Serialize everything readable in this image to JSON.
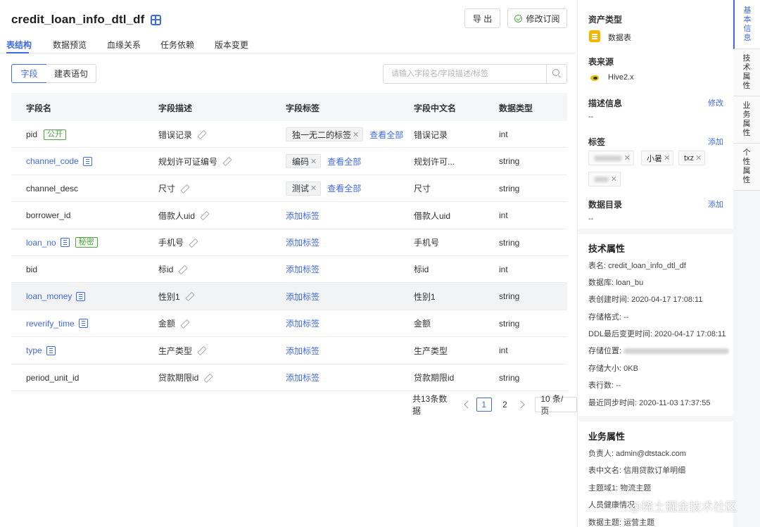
{
  "header": {
    "title": "credit_loan_info_dtl_df",
    "export_label": "导 出",
    "subscribe_label": "修改订阅"
  },
  "tabs": [
    "表结构",
    "数据预览",
    "血缘关系",
    "任务依赖",
    "版本变更"
  ],
  "segments": {
    "field": "字段",
    "ddl": "建表语句"
  },
  "search": {
    "placeholder": "请输入字段名/字段描述/标签"
  },
  "table": {
    "columns": [
      "字段名",
      "字段描述",
      "字段标签",
      "字段中文名",
      "数据类型"
    ],
    "rows": [
      {
        "name": "pid",
        "badge": "公开",
        "desc": "错误记录",
        "tag": "独一无二的标签",
        "cn": "错误记录",
        "type": "int"
      },
      {
        "name": "channel_code",
        "desc": "规划许可证编号",
        "tag": "编码",
        "cn": "规划许可...",
        "type": "string"
      },
      {
        "name": "channel_desc",
        "desc": "尺寸",
        "tag": "测试",
        "cn": "尺寸",
        "type": "string"
      },
      {
        "name": "borrower_id",
        "desc": "借款人uid",
        "add": "添加标签",
        "cn": "借款人uid",
        "type": "int"
      },
      {
        "name": "loan_no",
        "badge": "秘密",
        "desc": "手机号",
        "add": "添加标签",
        "cn": "手机号",
        "type": "string"
      },
      {
        "name": "bid",
        "desc": "标id",
        "add": "添加标签",
        "cn": "标id",
        "type": "int"
      },
      {
        "name": "loan_money",
        "desc": "性别1",
        "add": "添加标签",
        "cn": "性别1",
        "type": "string"
      },
      {
        "name": "reverify_time",
        "desc": "金额",
        "add": "添加标签",
        "cn": "金额",
        "type": "string"
      },
      {
        "name": "type",
        "desc": "生产类型",
        "add": "添加标签",
        "cn": "生产类型",
        "type": "int"
      },
      {
        "name": "period_unit_id",
        "desc": "贷款期限id",
        "add": "添加标签",
        "cn": "贷款期限id",
        "type": "string"
      }
    ],
    "view_all": "查看全部"
  },
  "pagination": {
    "total": "共13条数据",
    "page1": "1",
    "page2": "2",
    "size": "10 条/页"
  },
  "panel": {
    "asset_type_label": "资产类型",
    "asset_type": "数据表",
    "source_label": "表来源",
    "source": "Hive2.x",
    "desc_label": "描述信息",
    "desc_edit": "修改",
    "desc_value": "--",
    "tags_label": "标签",
    "tags_add": "添加",
    "tags": [
      "小暑",
      "txz"
    ],
    "catalog_label": "数据目录",
    "catalog_add": "添加",
    "catalog_value": "--",
    "tech_title": "技术属性",
    "tech": [
      "表名: credit_loan_info_dtl_df",
      "数据库: loan_bu",
      "表创建时间: 2020-04-17 17:08:11",
      "存储格式: --",
      "DDL最后变更时间: 2020-04-17 17:08:11",
      "存储位置:",
      "存储大小: 0KB",
      "表行数: --",
      "最近同步时间: 2020-11-03 17:37:55"
    ],
    "biz_title": "业务属性",
    "biz": [
      "负责人: admin@dtstack.com",
      "表中文名: 信用贷款订单明细",
      "主题域1: 物流主题",
      "人员健康情况",
      "数据主题: 运营主题"
    ]
  },
  "side_tabs": [
    "基本信息",
    "技术属性",
    "业务属性",
    "个性属性"
  ],
  "watermark": "@稀土掘金技术社区",
  "colors": {
    "accent": "#3f6bdf",
    "green": "#52a447",
    "doc": "#f4b400"
  }
}
